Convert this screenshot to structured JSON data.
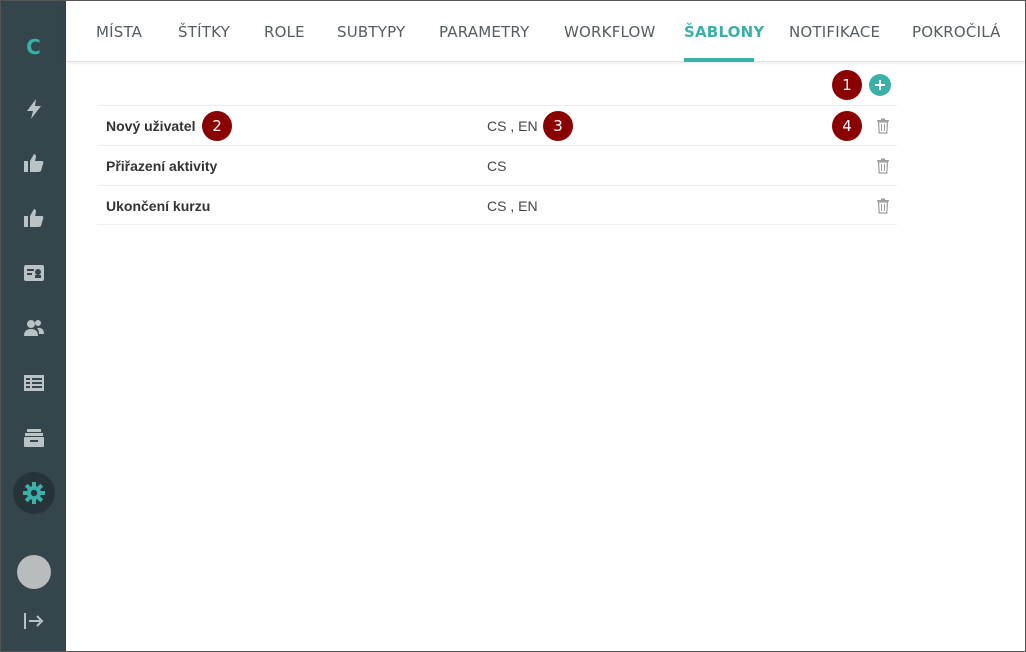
{
  "sidebar": {
    "logo": "C",
    "items": [
      {
        "icon": "bolt-icon"
      },
      {
        "icon": "thumbs-up-icon"
      },
      {
        "icon": "thumbs-up-icon"
      },
      {
        "icon": "id-card-icon"
      },
      {
        "icon": "users-icon"
      },
      {
        "icon": "table-icon"
      },
      {
        "icon": "archive-icon"
      },
      {
        "icon": "gear-icon",
        "active": true
      }
    ],
    "bottom": [
      {
        "icon": "avatar"
      },
      {
        "icon": "logout-icon"
      }
    ]
  },
  "tabs": [
    {
      "label": "MÍSTA"
    },
    {
      "label": "ŠTÍTKY"
    },
    {
      "label": "ROLE"
    },
    {
      "label": "SUBTYPY"
    },
    {
      "label": "PARAMETRY"
    },
    {
      "label": "WORKFLOW"
    },
    {
      "label": "ŠABLONY",
      "active": true
    },
    {
      "label": "NOTIFIKACE"
    },
    {
      "label": "POKROČILÁ"
    }
  ],
  "templates": [
    {
      "name": "Nový uživatel",
      "languages": "CS , EN"
    },
    {
      "name": "Přiřazení aktivity",
      "languages": "CS"
    },
    {
      "name": "Ukončení kurzu",
      "languages": "CS , EN"
    }
  ],
  "markers": [
    "1",
    "2",
    "3",
    "4"
  ],
  "colors": {
    "accent": "#3ab1a8",
    "sidebar": "#34454c",
    "marker": "#8b0000"
  }
}
